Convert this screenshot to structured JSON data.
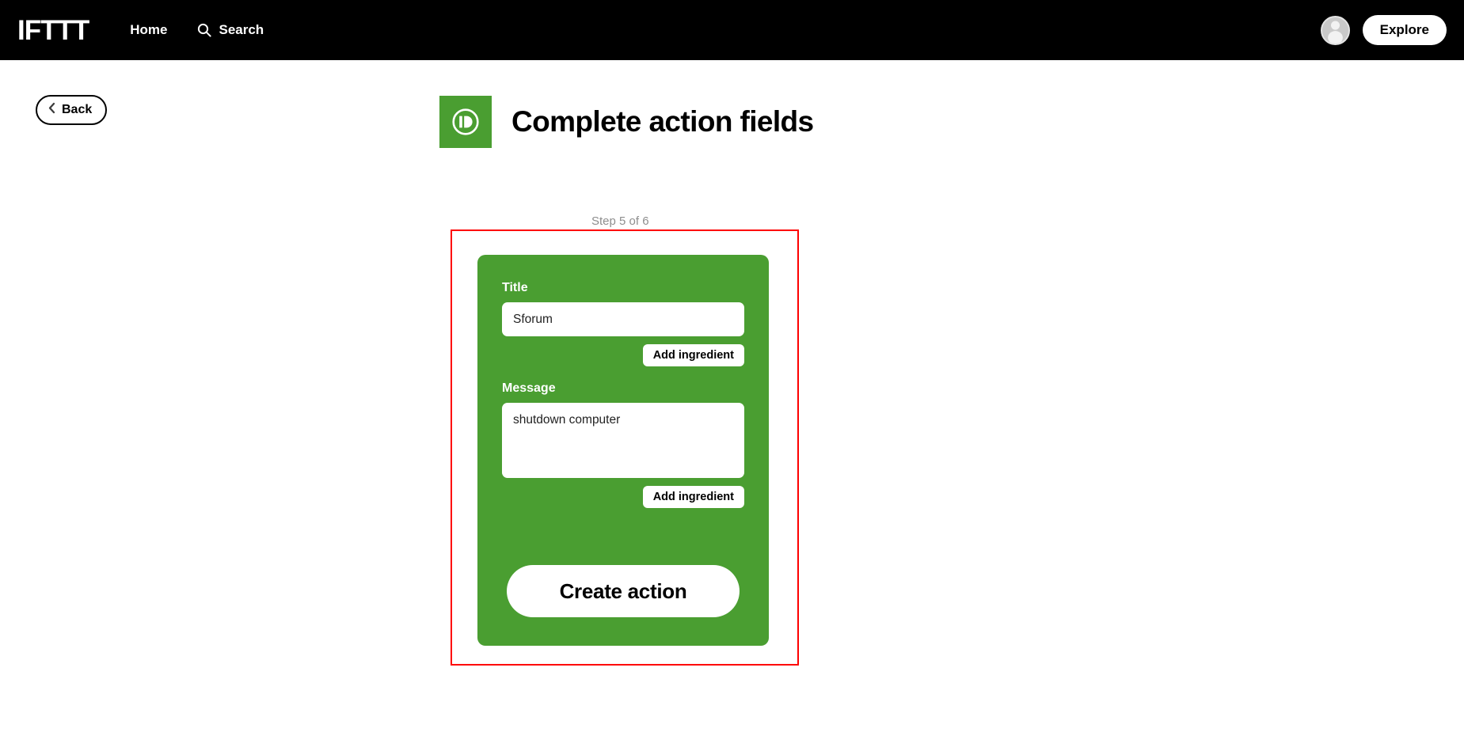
{
  "header": {
    "brand": "IFTTT",
    "nav": [
      {
        "label": "Home",
        "icon": ""
      },
      {
        "label": "Search",
        "icon": "search-icon"
      }
    ],
    "avatar_icon": "user-avatar-icon",
    "explore_label": "Explore"
  },
  "page": {
    "back_label": "Back",
    "back_icon": "chevron-left-icon",
    "service_icon": "pushbullet-icon",
    "title": "Complete action fields",
    "step": "Step 5 of 6"
  },
  "form": {
    "fields": [
      {
        "label": "Title",
        "value": "Sforum",
        "placeholder": "",
        "add_ingredient_label": "Add ingredient"
      },
      {
        "label": "Message",
        "value": "shutdown computer",
        "placeholder": "",
        "add_ingredient_label": "Add ingredient"
      }
    ],
    "submit_label": "Create action"
  },
  "colors": {
    "brand_green": "#4a9e31",
    "header_black": "#000000",
    "highlight_red": "#fe0000",
    "step_gray": "#8e8e8e"
  }
}
